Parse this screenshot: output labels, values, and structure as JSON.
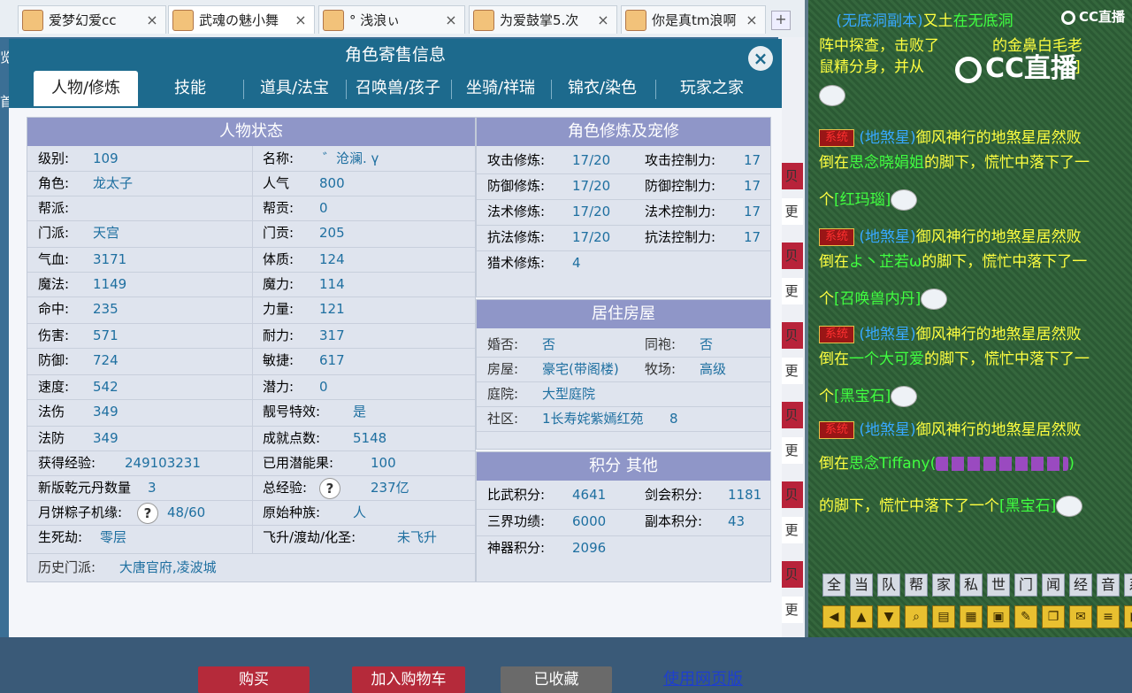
{
  "browser_tabs": [
    {
      "label": "爱梦幻爱cc",
      "active": false
    },
    {
      "label": "武魂の魅小舞",
      "active": true
    },
    {
      "label": "° 浅浪ぃ",
      "active": false
    },
    {
      "label": "为爱鼓掌5.次",
      "active": false
    },
    {
      "label": "你是真tm浪啊",
      "active": false
    }
  ],
  "tab_plus": "+",
  "tab_close": "×",
  "dialog": {
    "title": "角色寄售信息",
    "close": "×",
    "nav": [
      "人物/修炼",
      "技能",
      "道具/法宝",
      "召唤兽/孩子",
      "坐骑/祥瑞",
      "锦衣/染色",
      "玩家之家"
    ]
  },
  "status": {
    "header": "人物状态",
    "rows": [
      {
        "l1": "级别:",
        "v1": "109",
        "l2": "名称:",
        "v2": "゛沧澜. ү"
      },
      {
        "l1": "角色:",
        "v1": "龙太子",
        "l2": "人气",
        "v2": "800"
      },
      {
        "l1": "帮派:",
        "v1": "",
        "l2": "帮贡:",
        "v2": "0"
      },
      {
        "l1": "门派:",
        "v1": "天宫",
        "l2": "门贡:",
        "v2": "205"
      },
      {
        "l1": "气血:",
        "v1": "3171",
        "l2": "体质:",
        "v2": "124"
      },
      {
        "l1": "魔法:",
        "v1": "1149",
        "l2": "魔力:",
        "v2": "114"
      },
      {
        "l1": "命中:",
        "v1": "235",
        "l2": "力量:",
        "v2": "121"
      },
      {
        "l1": "伤害:",
        "v1": "571",
        "l2": "耐力:",
        "v2": "317"
      },
      {
        "l1": "防御:",
        "v1": "724",
        "l2": "敏捷:",
        "v2": "617"
      },
      {
        "l1": "速度:",
        "v1": "542",
        "l2": "潜力:",
        "v2": "0"
      },
      {
        "l1": "法伤",
        "v1": "349",
        "l2": "靓号特效:",
        "v2": "是"
      },
      {
        "l1": "法防",
        "v1": "349",
        "l2": "成就点数:",
        "v2": "5148"
      },
      {
        "l1": "获得经验:",
        "v1": "249103231",
        "l2": "已用潜能果:",
        "v2": "100"
      },
      {
        "l1": "新版乾元丹数量",
        "v1": "3",
        "l2": "总经验:",
        "v2": "237亿"
      },
      {
        "l1": "月饼粽子机缘:",
        "v1": "48/60",
        "l2": "原始种族:",
        "v2": "人"
      },
      {
        "l1": "生死劫:",
        "v1": "零层",
        "l2": "飞升/渡劫/化圣:",
        "v2": "未飞升"
      }
    ],
    "history_label": "历史门派:",
    "history_value": "大唐官府,凌波城",
    "help_mark": "?"
  },
  "cultivation": {
    "header": "角色修炼及宠修",
    "rows": [
      {
        "l1": "攻击修炼:",
        "v1": "17/20",
        "l2": "攻击控制力:",
        "v2": "17"
      },
      {
        "l1": "防御修炼:",
        "v1": "17/20",
        "l2": "防御控制力:",
        "v2": "17"
      },
      {
        "l1": "法术修炼:",
        "v1": "17/20",
        "l2": "法术控制力:",
        "v2": "17"
      },
      {
        "l1": "抗法修炼:",
        "v1": "17/20",
        "l2": "抗法控制力:",
        "v2": "17"
      },
      {
        "l1": "猎术修炼:",
        "v1": "4",
        "l2": "",
        "v2": ""
      }
    ]
  },
  "house": {
    "header": "居住房屋",
    "marriage_label": "婚否:",
    "marriage_value": "否",
    "robe_label": "同袍:",
    "robe_value": "否",
    "house_label": "房屋:",
    "house_value": "豪宅(带阁楼)",
    "ranch_label": "牧场:",
    "ranch_value": "高级",
    "yard_label": "庭院:",
    "yard_value": "大型庭院",
    "community_label": "社区:",
    "community_value": "1长寿姹紫嫣红苑",
    "community_num": "8"
  },
  "points": {
    "header": "积分 其他",
    "rows": [
      {
        "l1": "比武积分:",
        "v1": "4641",
        "l2": "剑会积分:",
        "v2": "1181"
      },
      {
        "l1": "三界功绩:",
        "v1": "6000",
        "l2": "副本积分:",
        "v2": "43"
      },
      {
        "l1": "神器积分:",
        "v1": "2096",
        "l2": "",
        "v2": ""
      }
    ]
  },
  "actions": {
    "buy": "购买",
    "add_cart": "加入购物车",
    "collected": "已收藏",
    "web_version": "使用网页版"
  },
  "left_edge": {
    "partial": [
      "览",
      "首"
    ]
  },
  "right_edge_buttons": [
    "贝",
    "更",
    "贝",
    "更",
    "贝",
    "更",
    "贝",
    "更",
    "贝",
    "更",
    "贝",
    "更"
  ],
  "chat": {
    "logo": "CC直播",
    "logo_small": "CC直播",
    "sys_tag": "系统",
    "top_line1_a": "(无底洞副本)",
    "top_line1_b": "又土",
    "top_line1_c": "在无底洞",
    "top_line2": "阵中探查，击败了",
    "top_line2_b": "的金鼻白毛老",
    "top_line3": "鼠精分身，并从",
    "top_line3_b": "]",
    "lines": [
      {
        "src": "(地煞星)",
        "a": "御风神行的地煞星居然败",
        "b_pre": "倒在",
        "who": "思念晓娟姐",
        "b_post": "的脚下，慌忙中落下了一",
        "c_pre": "个",
        "item": "[红玛瑙]"
      },
      {
        "src": "(地煞星)",
        "a": "御风神行的地煞星居然败",
        "b_pre": "倒在",
        "who": "よ丶芷若ω",
        "b_post": "的脚下，慌忙中落下了一",
        "c_pre": "个",
        "item": "[召唤兽内丹]"
      },
      {
        "src": "(地煞星)",
        "a": "御风神行的地煞星居然败",
        "b_pre": "倒在",
        "who": "一个大可爱",
        "b_post": "的脚下，慌忙中落下了一",
        "c_pre": "个",
        "item": "[黑宝石]"
      },
      {
        "src": "(地煞星)",
        "a": "御风神行的地煞星居然败",
        "b_pre": "倒在",
        "who": "思念Tiffany",
        "b_post": "",
        "c_pre": "的脚下，慌忙中落下了一个",
        "item": "[黑宝石]"
      }
    ],
    "tiffany_suffix": "(",
    "tiffany_end": ")",
    "channels": [
      "全",
      "当",
      "队",
      "帮",
      "家",
      "私",
      "世",
      "门",
      "闻",
      "经",
      "音",
      "系"
    ],
    "tool_icons": [
      "left-arrow-icon",
      "up-arrow-icon",
      "down-arrow-icon",
      "search-icon",
      "doc-icon",
      "grid-icon",
      "lock-icon",
      "brush-icon",
      "copy-icon",
      "chat-icon",
      "list-icon",
      "right-arrow-icon"
    ]
  }
}
